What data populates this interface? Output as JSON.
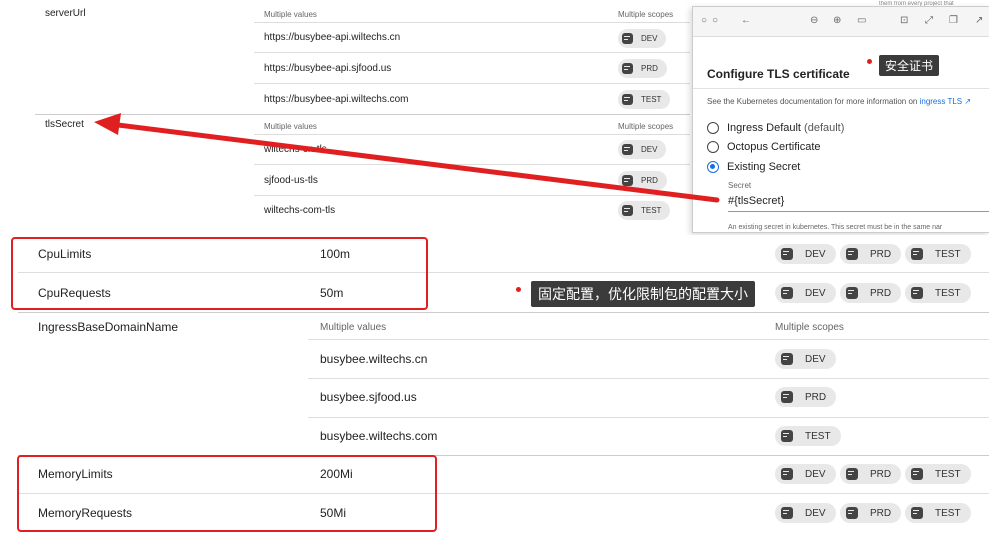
{
  "top_panel": {
    "serverUrl": {
      "name": "serverUrl",
      "values_header": "Multiple values",
      "scopes_header": "Multiple scopes",
      "rows": [
        {
          "value": "https://busybee-api.wiltechs.cn",
          "scope": "DEV"
        },
        {
          "value": "https://busybee-api.sjfood.us",
          "scope": "PRD"
        },
        {
          "value": "https://busybee-api.wiltechs.com",
          "scope": "TEST"
        }
      ]
    },
    "tlsSecret": {
      "name": "tlsSecret",
      "values_header": "Multiple values",
      "scopes_header": "Multiple scopes",
      "rows": [
        {
          "value": "wiltechs-cn-tls",
          "scope": "DEV"
        },
        {
          "value": "sjfood-us-tls",
          "scope": "PRD"
        },
        {
          "value": "wiltechs-com-tls",
          "scope": "TEST"
        }
      ]
    },
    "top_right_snippet": "them from every project that"
  },
  "tls_dialog": {
    "toolbar_icons": [
      "circle-icon",
      "circle-icon",
      "back-arrow-icon",
      "zoom-out-icon",
      "zoom-in-icon",
      "frame-icon",
      "crop-icon",
      "resize-icon",
      "window-icon",
      "share-icon"
    ],
    "title": "Configure TLS certificate",
    "description": "See the Kubernetes documentation for more information on",
    "description_link": "ingress TLS",
    "options": [
      {
        "label": "Ingress Default",
        "suffix": "(default)",
        "selected": false
      },
      {
        "label": "Octopus Certificate",
        "suffix": "",
        "selected": false
      },
      {
        "label": "Existing Secret",
        "suffix": "",
        "selected": true
      }
    ],
    "secret_label": "Secret",
    "secret_value": "#{tlsSecret}",
    "footer_text": "An existing secret in kubernetes. This secret must be in the same nar"
  },
  "annotations": {
    "tls_callout": "安全证书",
    "fixed_config_callout": "固定配置，优化限制包的配置大小"
  },
  "bottom_panel": {
    "cpu_limits": {
      "name": "CpuLimits",
      "value": "100m",
      "scopes": [
        "DEV",
        "PRD",
        "TEST"
      ]
    },
    "cpu_requests": {
      "name": "CpuRequests",
      "value": "50m",
      "scopes": [
        "DEV",
        "PRD",
        "TEST"
      ]
    },
    "ingress": {
      "name": "IngressBaseDomainName",
      "values_header": "Multiple values",
      "scopes_header": "Multiple scopes",
      "rows": [
        {
          "value": "busybee.wiltechs.cn",
          "scope": "DEV"
        },
        {
          "value": "busybee.sjfood.us",
          "scope": "PRD"
        },
        {
          "value": "busybee.wiltechs.com",
          "scope": "TEST"
        }
      ]
    },
    "memory_limits": {
      "name": "MemoryLimits",
      "value": "200Mi",
      "scopes": [
        "DEV",
        "PRD",
        "TEST"
      ]
    },
    "memory_requests": {
      "name": "MemoryRequests",
      "value": "50Mi",
      "scopes": [
        "DEV",
        "PRD",
        "TEST"
      ]
    }
  },
  "colors": {
    "highlight_red": "#e02020",
    "callout_bg": "#3b3b3b",
    "chip_bg": "#e8e8e8",
    "link_blue": "#1a6fe0"
  }
}
